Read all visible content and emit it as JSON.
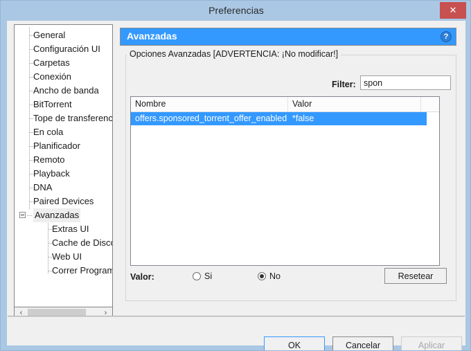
{
  "window": {
    "title": "Preferencias",
    "close_label": "✕",
    "accent_color": "#3399ff",
    "titlebar_color": "#aac7e4",
    "close_color": "#c75050"
  },
  "sidebar": {
    "items": [
      {
        "label": "General",
        "level": 0
      },
      {
        "label": "Configuración UI",
        "level": 0
      },
      {
        "label": "Carpetas",
        "level": 0
      },
      {
        "label": "Conexión",
        "level": 0
      },
      {
        "label": "Ancho de banda",
        "level": 0
      },
      {
        "label": "BitTorrent",
        "level": 0
      },
      {
        "label": "Tope de transferenc",
        "level": 0
      },
      {
        "label": "En cola",
        "level": 0
      },
      {
        "label": "Planificador",
        "level": 0
      },
      {
        "label": "Remoto",
        "level": 0
      },
      {
        "label": "Playback",
        "level": 0
      },
      {
        "label": "DNA",
        "level": 0
      },
      {
        "label": "Paired Devices",
        "level": 0
      },
      {
        "label": "Avanzadas",
        "level": 0
      },
      {
        "label": "Extras UI",
        "level": 1
      },
      {
        "label": "Cache de Disco",
        "level": 1
      },
      {
        "label": "Web UI",
        "level": 1
      },
      {
        "label": "Correr Programa",
        "level": 1
      }
    ],
    "expander_glyph": "−",
    "scroll_left_glyph": "‹",
    "scroll_right_glyph": "›"
  },
  "section": {
    "header_title": "Avanzadas",
    "help_glyph": "?"
  },
  "groupbox": {
    "legend": "Opciones Avanzadas [ADVERTENCIA: ¡No modificar!]"
  },
  "filter": {
    "label": "Filter:",
    "value": "spon",
    "placeholder": ""
  },
  "listview": {
    "columns": [
      "Nombre",
      "Valor",
      ""
    ],
    "rows": [
      {
        "name": "offers.sponsored_torrent_offer_enabled",
        "value": "*false",
        "selected": true
      }
    ]
  },
  "value_row": {
    "label": "Valor:",
    "option_yes": "Si",
    "option_no": "No",
    "selected": "No",
    "reset_label": "Resetear"
  },
  "footer": {
    "ok_label": "OK",
    "cancel_label": "Cancelar",
    "apply_label": "Aplicar"
  }
}
